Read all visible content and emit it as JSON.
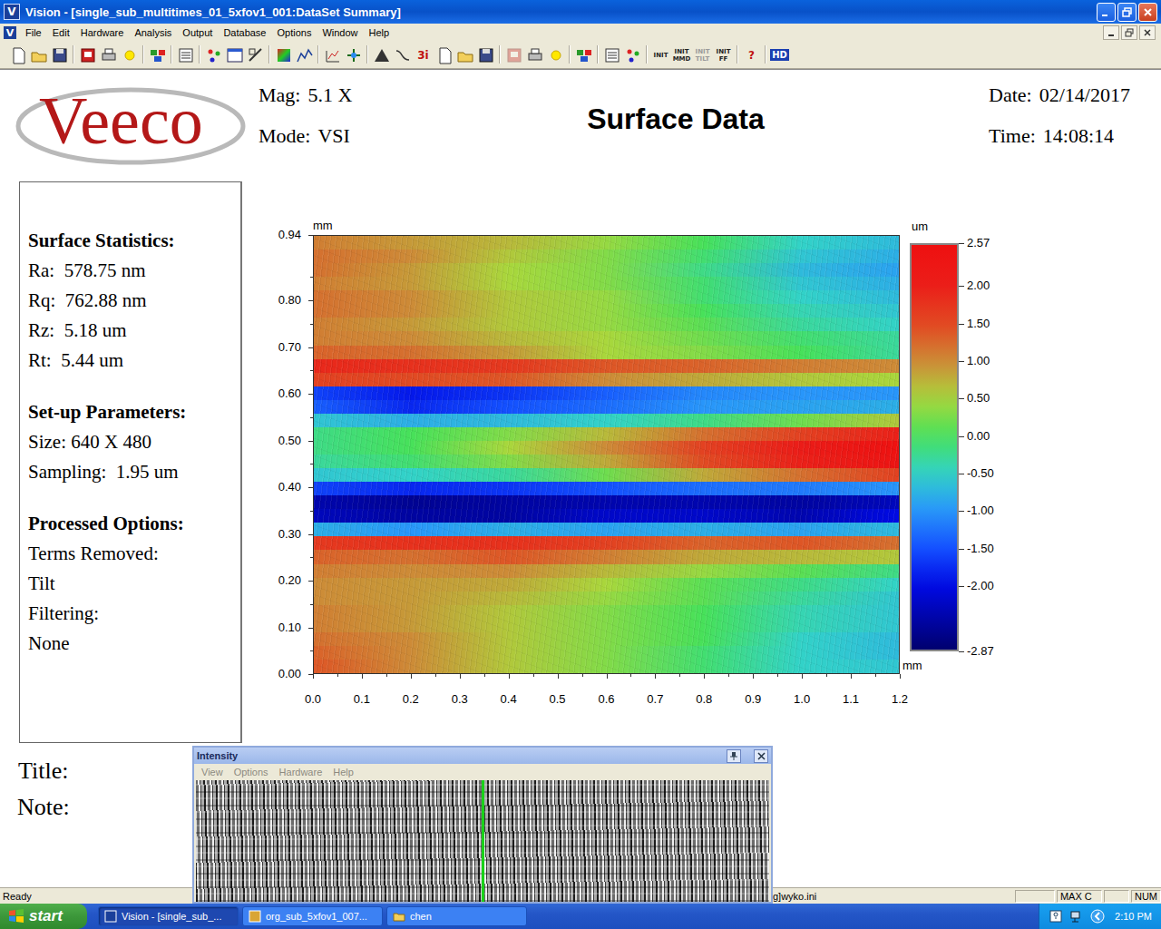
{
  "window": {
    "title": "Vision - [single_sub_multitimes_01_5xfov1_001:DataSet Summary]",
    "icon": "V"
  },
  "menu": {
    "icon": "V",
    "items": [
      "File",
      "Edit",
      "Hardware",
      "Analysis",
      "Output",
      "Database",
      "Options",
      "Window",
      "Help"
    ]
  },
  "toolbar": [
    {
      "kind": "icon",
      "disabled": false
    },
    {
      "kind": "icon",
      "disabled": false
    },
    {
      "kind": "icon",
      "disabled": false
    },
    {
      "kind": "separator",
      "disabled": false
    },
    {
      "kind": "icon",
      "disabled": false
    },
    {
      "kind": "icon",
      "disabled": false
    },
    {
      "kind": "icon",
      "disabled": false
    },
    {
      "kind": "separator",
      "disabled": false
    },
    {
      "kind": "icon",
      "disabled": false
    },
    {
      "kind": "separator",
      "disabled": false
    },
    {
      "kind": "icon",
      "disabled": false
    },
    {
      "kind": "separator",
      "disabled": false
    },
    {
      "kind": "icon",
      "disabled": false
    },
    {
      "kind": "icon",
      "disabled": false
    },
    {
      "kind": "icon",
      "disabled": false
    },
    {
      "kind": "separator",
      "disabled": false
    },
    {
      "kind": "icon",
      "disabled": false
    },
    {
      "kind": "icon",
      "disabled": false
    },
    {
      "kind": "separator",
      "disabled": false
    },
    {
      "kind": "icon",
      "disabled": false
    },
    {
      "kind": "icon",
      "disabled": false
    },
    {
      "kind": "separator",
      "disabled": false
    },
    {
      "kind": "icon",
      "disabled": false
    },
    {
      "kind": "icon",
      "disabled": false
    },
    {
      "kind": "text",
      "label": "3i",
      "disabled": false
    },
    {
      "kind": "icon",
      "disabled": false
    },
    {
      "kind": "icon",
      "disabled": false
    },
    {
      "kind": "icon",
      "disabled": false
    },
    {
      "kind": "separator",
      "disabled": false
    },
    {
      "kind": "icon",
      "disabled": true
    },
    {
      "kind": "icon",
      "disabled": false
    },
    {
      "kind": "icon",
      "disabled": false
    },
    {
      "kind": "separator",
      "disabled": false
    },
    {
      "kind": "icon",
      "disabled": false
    },
    {
      "kind": "separator",
      "disabled": false
    },
    {
      "kind": "icon",
      "disabled": false
    },
    {
      "kind": "icon",
      "disabled": false
    },
    {
      "kind": "separator",
      "disabled": false
    },
    {
      "kind": "text",
      "label": "INIT",
      "disabled": false
    },
    {
      "kind": "text",
      "label": "INIT MMD",
      "disabled": false
    },
    {
      "kind": "text",
      "label": "INIT TILT",
      "disabled": true
    },
    {
      "kind": "text",
      "label": "INIT FF",
      "disabled": false
    },
    {
      "kind": "separator",
      "disabled": false
    },
    {
      "kind": "text",
      "label": "?",
      "disabled": false
    },
    {
      "kind": "separator",
      "disabled": false
    },
    {
      "kind": "text",
      "label": "HD",
      "disabled": false
    }
  ],
  "report": {
    "logo": "Veeco",
    "mag": {
      "label": "Mag:",
      "value": "5.1 X"
    },
    "mode": {
      "label": "Mode:",
      "value": "VSI"
    },
    "title": "Surface Data",
    "date": {
      "label": "Date:",
      "value": "02/14/2017"
    },
    "time": {
      "label": "Time:",
      "value": "14:08:14"
    },
    "panel": [
      {
        "heading": "Surface Statistics:",
        "lines": [
          "Ra:  578.75 nm",
          "Rq:  762.88 nm",
          "Rz:  5.18 um",
          "Rt:  5.44 um"
        ]
      },
      {
        "heading": "Set-up Parameters:",
        "lines": [
          "Size: 640 X 480",
          "Sampling:  1.95 um"
        ]
      },
      {
        "heading": "Processed Options:",
        "lines": [
          "Terms Removed:",
          "Tilt",
          "Filtering:",
          "None"
        ]
      }
    ],
    "title_label": "Title:",
    "note_label": "Note:"
  },
  "plot": {
    "y_unit": "mm",
    "x_unit": "mm",
    "y_range": [
      0,
      0.94
    ],
    "x_range": [
      0,
      1.2
    ],
    "y_ticks": [
      "0.94",
      "0.80",
      "0.70",
      "0.60",
      "0.50",
      "0.40",
      "0.30",
      "0.20",
      "0.10",
      "0.00"
    ],
    "x_ticks": [
      "0.0",
      "0.1",
      "0.2",
      "0.3",
      "0.4",
      "0.5",
      "0.6",
      "0.7",
      "0.8",
      "0.9",
      "1.0",
      "1.1",
      "1.2"
    ],
    "colorbar": {
      "unit": "um",
      "min": -2.87,
      "max": 2.57,
      "ticks": [
        "2.57",
        "2.00",
        "1.50",
        "1.00",
        "0.50",
        "0.00",
        "-0.50",
        "-1.00",
        "-1.50",
        "-2.00",
        "-2.87"
      ]
    },
    "heights_um": [
      [
        1.1,
        0.9,
        0.7,
        0.4,
        0.0,
        -0.5,
        -0.7
      ],
      [
        1.2,
        1.0,
        0.6,
        0.3,
        -0.1,
        -0.6,
        -0.8
      ],
      [
        1.2,
        0.9,
        0.5,
        0.3,
        -0.2,
        -0.7,
        -0.9
      ],
      [
        1.1,
        0.9,
        0.5,
        0.3,
        -0.1,
        -0.6,
        -0.8
      ],
      [
        1.2,
        1.0,
        0.6,
        0.4,
        -0.1,
        -0.5,
        -0.7
      ],
      [
        1.2,
        1.0,
        0.6,
        0.4,
        0.0,
        -0.4,
        -0.6
      ],
      [
        1.1,
        0.9,
        0.6,
        0.4,
        0.1,
        -0.3,
        -0.5
      ],
      [
        1.1,
        1.0,
        0.7,
        0.5,
        0.2,
        -0.1,
        -0.3
      ],
      [
        1.3,
        1.2,
        0.9,
        0.5,
        0.3,
        0.0,
        -0.3
      ],
      [
        1.9,
        1.8,
        1.7,
        1.4,
        1.3,
        1.1,
        1.0
      ],
      [
        1.6,
        1.5,
        1.4,
        1.0,
        0.8,
        0.6,
        0.5
      ],
      [
        -1.6,
        -1.9,
        -1.7,
        -1.4,
        -1.1,
        -1.0,
        -1.0
      ],
      [
        -1.4,
        -1.8,
        -1.5,
        -1.3,
        -1.0,
        -0.9,
        -0.8
      ],
      [
        -0.6,
        -0.8,
        -0.7,
        -0.5,
        -0.2,
        0.2,
        0.6
      ],
      [
        -0.2,
        0.0,
        0.3,
        0.7,
        1.2,
        1.6,
        2.0
      ],
      [
        -0.2,
        0.0,
        0.5,
        1.0,
        1.6,
        2.1,
        2.5
      ],
      [
        -0.3,
        -0.1,
        0.3,
        0.8,
        1.5,
        2.0,
        2.4
      ],
      [
        -0.6,
        -0.5,
        -0.3,
        0.2,
        0.8,
        1.2,
        1.6
      ],
      [
        -1.6,
        -1.8,
        -1.7,
        -1.5,
        -1.3,
        -1.2,
        -1.0
      ],
      [
        -2.4,
        -2.6,
        -2.5,
        -2.4,
        -2.4,
        -2.5,
        -2.3
      ],
      [
        -2.3,
        -2.5,
        -2.5,
        -2.2,
        -2.2,
        -2.4,
        -2.0
      ],
      [
        -0.8,
        -1.0,
        -0.8,
        -0.9,
        -0.8,
        -0.9,
        -0.7
      ],
      [
        1.7,
        1.8,
        1.8,
        1.6,
        1.3,
        1.4,
        1.2
      ],
      [
        1.3,
        1.2,
        1.4,
        1.1,
        0.8,
        0.7,
        0.6
      ],
      [
        1.1,
        1.0,
        1.0,
        0.7,
        0.4,
        0.1,
        -0.2
      ],
      [
        1.0,
        0.9,
        0.8,
        0.5,
        0.1,
        -0.2,
        -0.5
      ],
      [
        1.0,
        0.9,
        0.7,
        0.4,
        0.1,
        -0.3,
        -0.6
      ],
      [
        1.1,
        0.9,
        0.6,
        0.3,
        0.0,
        -0.4,
        -0.6
      ],
      [
        1.1,
        0.9,
        0.6,
        0.3,
        0.0,
        -0.4,
        -0.6
      ],
      [
        1.2,
        1.0,
        0.6,
        0.3,
        0.0,
        -0.5,
        -0.7
      ],
      [
        1.3,
        1.0,
        0.6,
        0.3,
        -0.1,
        -0.5,
        -0.7
      ],
      [
        1.4,
        1.0,
        0.6,
        0.3,
        -0.1,
        -0.5,
        -0.6
      ]
    ]
  },
  "intensity": {
    "title": "Intensity",
    "menu": [
      {
        "label": "View",
        "disabled": true
      },
      {
        "label": "Options",
        "disabled": true
      },
      {
        "label": "Hardware",
        "disabled": true
      },
      {
        "label": "Help",
        "disabled": true
      }
    ],
    "cursor": 0.5
  },
  "status_bar": {
    "text": "Ready",
    "path": "g]wyko.ini",
    "panes": [
      {
        "label": "MAX C"
      },
      {
        "label": "NUM"
      }
    ]
  },
  "taskbar": {
    "start": "start",
    "tasks": [
      {
        "label": "Vision - [single_sub_...",
        "selected": true
      },
      {
        "label": "org_sub_5xfov1_007...",
        "selected": false
      },
      {
        "label": "chen",
        "selected": false
      }
    ],
    "clock": "2:10 PM"
  }
}
